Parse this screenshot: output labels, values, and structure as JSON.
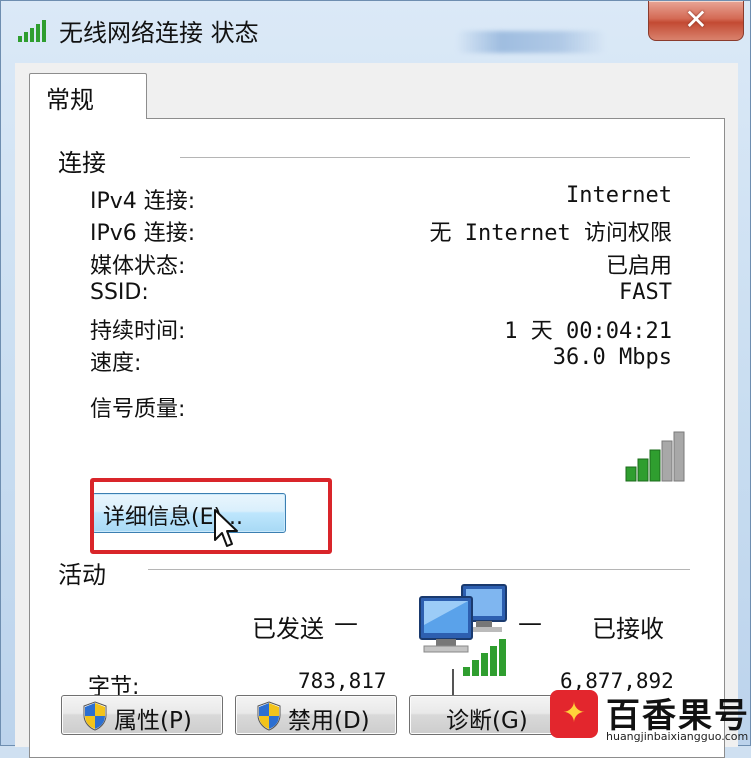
{
  "window": {
    "title": "无线网络连接 状态",
    "close_glyph": "✕"
  },
  "tab": {
    "label": "常规"
  },
  "connection": {
    "group_label": "连接",
    "rows": [
      {
        "label": "IPv4 连接:",
        "value": "Internet"
      },
      {
        "label": "IPv6 连接:",
        "value": "无 Internet 访问权限"
      },
      {
        "label": "媒体状态:",
        "value": "已启用"
      },
      {
        "label": "SSID:",
        "value": "FAST"
      },
      {
        "label": "持续时间:",
        "value": "1 天 00:04:21"
      },
      {
        "label": "速度:",
        "value": "36.0 Mbps"
      }
    ],
    "signal_label": "信号质量:",
    "signal_bars_active": 3,
    "signal_bars_total": 5,
    "details_button": "详细信息(E)..."
  },
  "activity": {
    "group_label": "活动",
    "sent_label": "已发送",
    "received_label": "已接收",
    "dash": "—",
    "bytes_label": "字节:",
    "bytes_sent": "783,817",
    "bytes_received": "6,877,892"
  },
  "buttons": {
    "properties": "属性(P)",
    "disable": "禁用(D)",
    "diagnose": "诊断(G)"
  },
  "watermark": {
    "logo_glyph": "✦",
    "title": "百香果号",
    "url": "huangjinbaixiangguo.com"
  },
  "colors": {
    "highlight_box": "#d9252a",
    "signal_green": "#2f9e2f",
    "title_bar": "#c7dcf0"
  },
  "icons": [
    "wifi-signal-icon",
    "network-computers-icon",
    "shield-icon",
    "mouse-cursor-icon"
  ]
}
